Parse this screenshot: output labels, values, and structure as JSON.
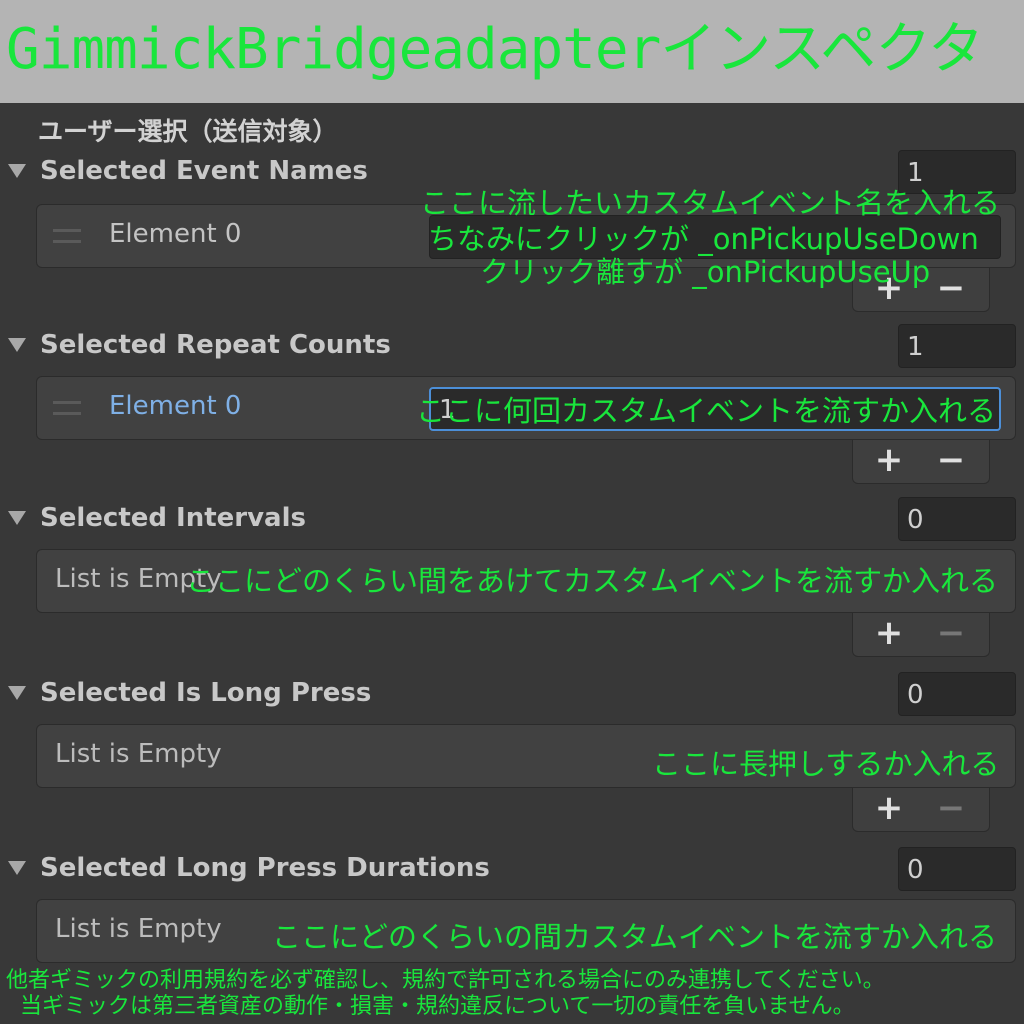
{
  "title": "GimmickBridgeadapterインスペクタ",
  "section_header": "ユーザー選択（送信対象）",
  "lists": {
    "event_names": {
      "label": "Selected Event Names",
      "size": "1",
      "element_label": "Element 0",
      "element_value": "",
      "plus": "+",
      "minus": "−"
    },
    "repeat_counts": {
      "label": "Selected Repeat Counts",
      "size": "1",
      "element_label": "Element 0",
      "element_value": "1",
      "plus": "+",
      "minus": "−"
    },
    "intervals": {
      "label": "Selected Intervals",
      "size": "0",
      "empty_text": "List is Empty",
      "plus": "+",
      "minus": "−"
    },
    "is_long_press": {
      "label": "Selected Is Long Press",
      "size": "0",
      "empty_text": "List is Empty",
      "plus": "+",
      "minus": "−"
    },
    "long_press_durations": {
      "label": "Selected Long Press Durations",
      "size": "0",
      "empty_text": "List is Empty"
    }
  },
  "notes": {
    "event_names_1": "ここに流したいカスタムイベント名を入れる",
    "event_names_2": "ちなみにクリックが _onPickupUseDown",
    "event_names_3": "クリック離すが _onPickupUseUp",
    "repeat_counts": "ここに何回カスタムイベントを流すか入れる",
    "intervals": "ここにどのくらい間をあけてカスタムイベントを流すか入れる",
    "is_long_press": "ここに長押しするか入れる",
    "long_press_durations": "ここにどのくらいの間カスタムイベントを流すか入れる"
  },
  "disclaimer": {
    "line1": "他者ギミックの利用規約を必ず確認し、規約で許可される場合にのみ連携してください。",
    "line2": "当ギミックは第三者資産の動作・損害・規約違反について一切の責任を負いません。"
  },
  "colors": {
    "annotation": "#19e63c",
    "panel_bg": "#383838",
    "title_bg": "#b4b4b4",
    "focus": "#4c8fd8"
  }
}
